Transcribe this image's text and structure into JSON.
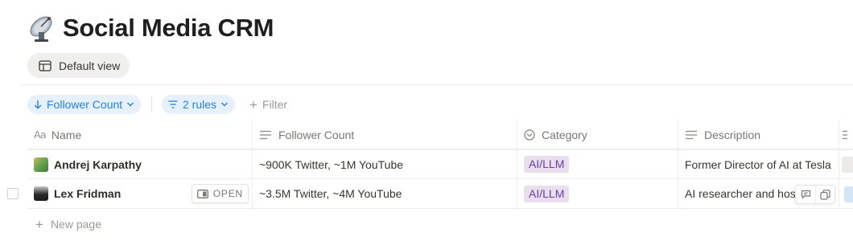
{
  "page": {
    "icon": "satellite-antenna-icon",
    "title": "Social Media CRM"
  },
  "views": {
    "active_label": "Default view",
    "active_icon": "table-icon"
  },
  "toolbar": {
    "sort_chip_label": "Follower Count",
    "rules_chip_label": "2 rules",
    "add_filter_label": "Filter"
  },
  "table": {
    "columns": [
      {
        "label": "Name",
        "icon": "title-aa-icon"
      },
      {
        "label": "Follower Count",
        "icon": "text-lines-icon"
      },
      {
        "label": "Category",
        "icon": "select-circle-icon"
      },
      {
        "label": "Description",
        "icon": "text-lines-icon"
      }
    ],
    "rows": [
      {
        "name": "Andrej Karpathy",
        "followers": "~900K Twitter, ~1M YouTube",
        "category": "AI/LLM",
        "description": "Former Director of AI at Tesla"
      },
      {
        "name": "Lex Fridman",
        "followers": "~3.5M Twitter, ~4M YouTube",
        "category": "AI/LLM",
        "description": "AI researcher and host"
      }
    ],
    "open_label": "OPEN",
    "new_page_label": "New page"
  },
  "colors": {
    "accent": "#2383e2",
    "chip_bg": "#e6f1fb",
    "tag_bg": "#e8deee",
    "tag_text": "#6940a5"
  }
}
